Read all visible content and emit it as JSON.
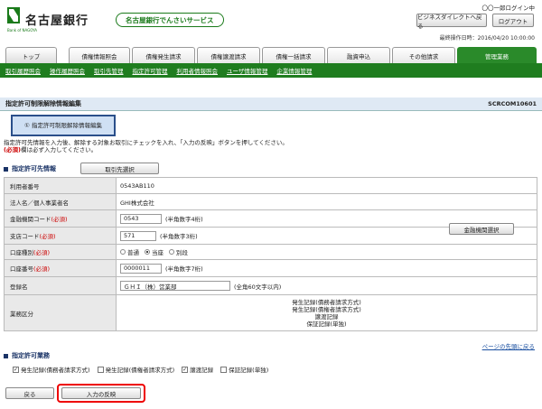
{
  "header": {
    "bank_name": "名古屋銀行",
    "logo_sub": "Bank of NAGOYA",
    "service_name": "名古屋銀行でんさいサービス",
    "user_label": "〇〇一郎ログイン中",
    "business_direct_btn": "ビジネスダイレクトへ戻る",
    "logout_btn": "ログアウト",
    "last_operation": "最終操作日時：2016/04/20 10:00:00"
  },
  "tabs": [
    {
      "label": "トップ"
    },
    {
      "label": "債権情報照会"
    },
    {
      "label": "債権発生請求"
    },
    {
      "label": "債権譲渡請求"
    },
    {
      "label": "債権一括請求"
    },
    {
      "label": "融資申込"
    },
    {
      "label": "その他請求"
    },
    {
      "label": "管理業務"
    }
  ],
  "subnav": [
    "取引履歴照会",
    "操作履歴照会",
    "取引先管理",
    "指定許可管理",
    "利用者情報照会",
    "ユーザ情報管理",
    "企業情報管理"
  ],
  "page": {
    "title": "指定許可制限解除情報編集",
    "code": "SCRCOM10601",
    "step": "① 指定許可制限解除情報編集",
    "instruction_1": "指定許可先情報を入力後、解除する対象お取引にチェックを入れ、「入力の反映」ボタンを押してください。",
    "instruction_req": "(必須)",
    "instruction_2": "欄は必ず入力してください。"
  },
  "section1": {
    "title": "指定許可先情報",
    "select_partner_btn": "取引先選択"
  },
  "form": {
    "user_no_label": "利用者番号",
    "user_no_value": "0543AB110",
    "corp_name_label": "法人名／個人事業者名",
    "corp_name_value": "GHI株式会社",
    "bank_code_label": "金融機関コード",
    "bank_code_value": "0543",
    "bank_code_hint": "(半角数字4桁)",
    "branch_code_label": "支店コード",
    "branch_code_value": "571",
    "branch_code_hint": "(半角数字3桁)",
    "account_type_label": "口座種別",
    "account_types": [
      "普通",
      "当座",
      "別段"
    ],
    "account_no_label": "口座番号",
    "account_no_value": "0000011",
    "account_no_hint": "(半角数字7桁)",
    "reg_name_label": "登録名",
    "reg_name_value": "ＧＨＩ（株）営業部",
    "reg_name_hint": "(全角60文字以内)",
    "business_label": "業務区分",
    "business_lines": [
      "発生記録(債務者請求方式)",
      "発生記録(債権者請求方式)",
      "譲渡記録",
      "保証記録(単独)"
    ],
    "required_mark": "(必須)",
    "bank_select_btn": "金融機関選択"
  },
  "page_top_link": "ページの先頭に戻る",
  "section2": {
    "title": "指定許可業務",
    "items": [
      {
        "label": "発生記録(債務者請求方式)",
        "checked": true
      },
      {
        "label": "発生記録(債権者請求方式)",
        "checked": false
      },
      {
        "label": "譲渡記録",
        "checked": true
      },
      {
        "label": "保証記録(単独)",
        "checked": false
      }
    ]
  },
  "actions": {
    "back_btn": "戻る",
    "apply_btn": "入力の反映"
  },
  "colors": {
    "brand_green": "#1f7d1f",
    "title_bg": "#dfe9f4",
    "required_red": "#cc0000",
    "highlight_red": "#ee0000"
  }
}
